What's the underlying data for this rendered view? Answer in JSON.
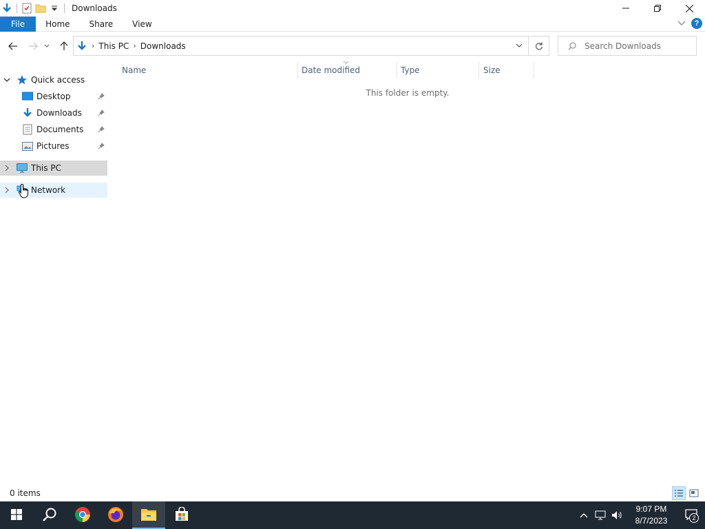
{
  "window": {
    "title": "Downloads"
  },
  "ribbon": {
    "tabs": [
      "File",
      "Home",
      "Share",
      "View"
    ]
  },
  "address": {
    "crumbs": [
      "This PC",
      "Downloads"
    ]
  },
  "search": {
    "placeholder": "Search Downloads"
  },
  "nav_pane": {
    "quick_access_label": "Quick access",
    "pinned": [
      {
        "label": "Desktop",
        "icon": "desktop-icon"
      },
      {
        "label": "Downloads",
        "icon": "downloads-icon"
      },
      {
        "label": "Documents",
        "icon": "documents-icon"
      },
      {
        "label": "Pictures",
        "icon": "pictures-icon"
      }
    ],
    "this_pc_label": "This PC",
    "network_label": "Network"
  },
  "columns": [
    "Name",
    "Date modified",
    "Type",
    "Size"
  ],
  "content": {
    "empty_message": "This folder is empty."
  },
  "status": {
    "item_count": "0 items"
  },
  "taskbar": {
    "apps": [
      "start-icon",
      "search-icon",
      "chrome-icon",
      "firefox-icon",
      "file-explorer-icon",
      "store-icon"
    ],
    "time": "9:07 PM",
    "date": "8/7/2023",
    "notification_count": "2"
  },
  "colors": {
    "accent": "#1979ca",
    "taskbar": "#1f2933",
    "selected_row": "#d9d9d9",
    "hover_row": "#e5f3ff"
  }
}
